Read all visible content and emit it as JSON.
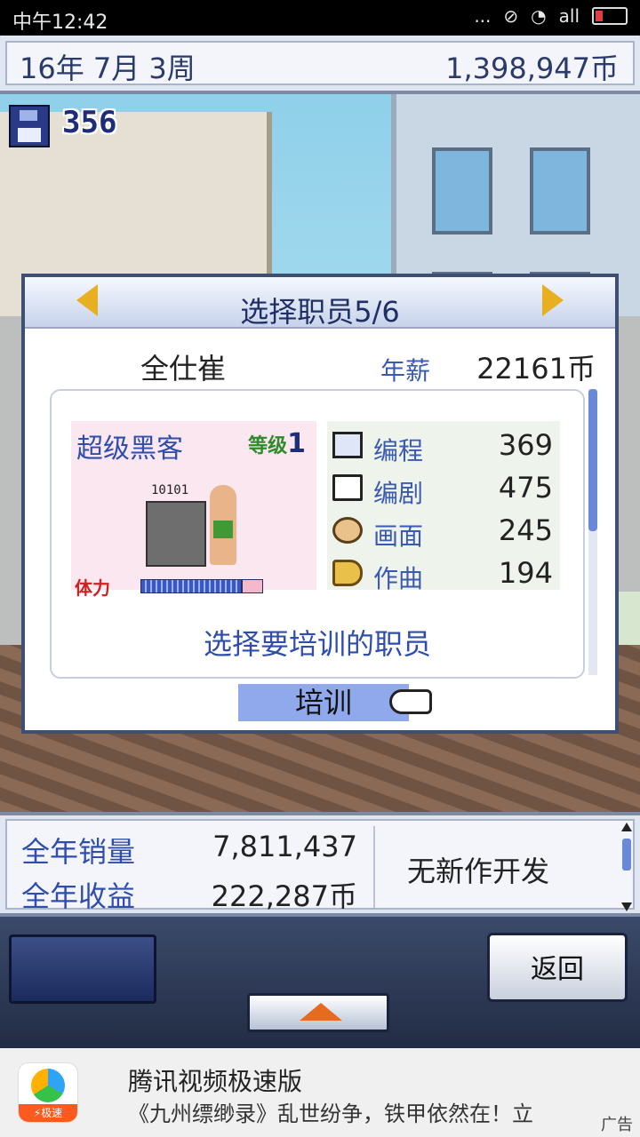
{
  "status_bar": {
    "time": "中午12:42",
    "dots": "...",
    "signal": "all"
  },
  "top_bar": {
    "date": "16年 7月 3周",
    "money": "1,398,947币"
  },
  "save": {
    "count": "356"
  },
  "dialog": {
    "title": "选择职员5/6",
    "employee_name": "全仕崔",
    "salary_label": "年薪",
    "salary_value": "22161币",
    "job": "超级黑客",
    "level_label": "等级",
    "level_value": "1",
    "screen_text": "10101",
    "stamina_label": "体力",
    "stats": [
      {
        "label": "编程",
        "value": "369",
        "icon": "computer-icon"
      },
      {
        "label": "编剧",
        "value": "475",
        "icon": "book-icon"
      },
      {
        "label": "画面",
        "value": "245",
        "icon": "palette-icon"
      },
      {
        "label": "作曲",
        "value": "194",
        "icon": "horn-icon"
      }
    ],
    "hint": "选择要培训的职员",
    "train_button": "培训"
  },
  "bottom_panel": {
    "annual_sales_label": "全年销量",
    "annual_sales_value": "7,811,437",
    "annual_revenue_label": "全年收益",
    "annual_revenue_value": "222,287币",
    "status": "无新作开发"
  },
  "controls": {
    "back_label": "返回"
  },
  "ad": {
    "title": "腾讯视频极速版",
    "description": "《九州缥缈录》乱世纷争，铁甲依然在！立",
    "icon_tag": "⚡极速",
    "ad_label": "广告"
  },
  "colors": {
    "accent": "#2f4dac",
    "dialog_border": "#3f4e73",
    "button_blue": "#8fa9ec",
    "arrow": "#e8b020"
  }
}
